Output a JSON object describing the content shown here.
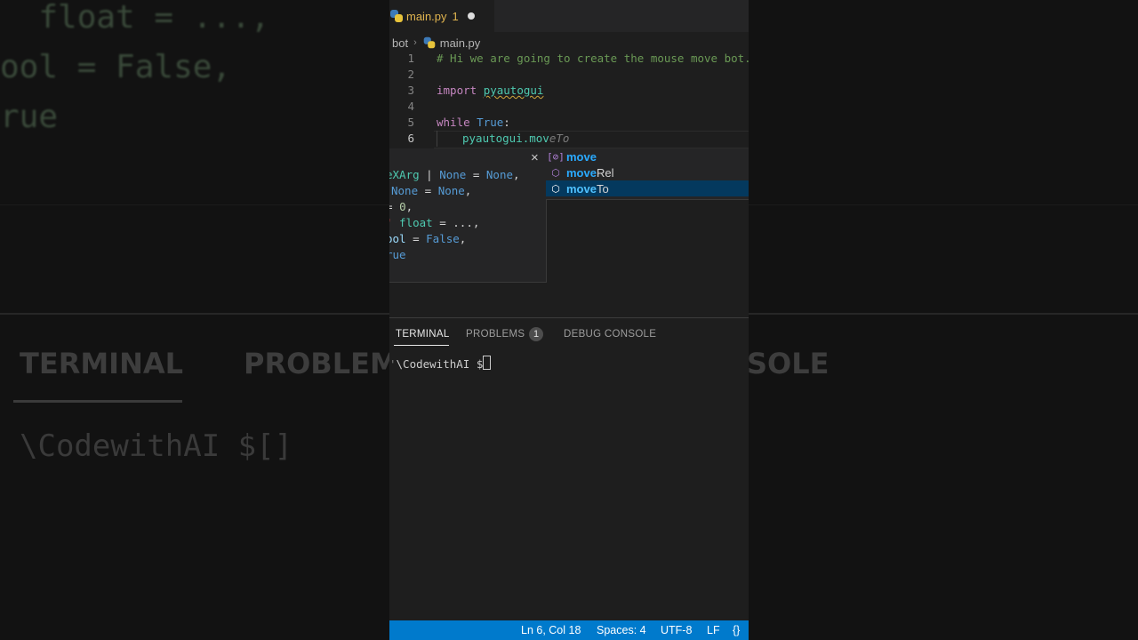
{
  "tab": {
    "filename": "main.py",
    "problem_count": "1"
  },
  "breadcrumb": {
    "folder": "bot",
    "separator": "›",
    "file": "main.py"
  },
  "editor": {
    "line_numbers": [
      "1",
      "2",
      "3",
      "4",
      "5",
      "6"
    ],
    "line1": "# Hi we are going to create the mouse move bot.",
    "line3_keyword": "import",
    "line3_module": "pyautogui",
    "line5_keyword": "while",
    "line5_const": "True",
    "line5_colon": ":",
    "line6_typed": "pyautogui.mov",
    "line6_ghost": "eTo"
  },
  "param_hint": {
    "close_label": "×",
    "line1_a": "eXArg",
    "line1_b": " | ",
    "line1_c": "None",
    "line1_d": " = ",
    "line1_e": "None",
    "line1_f": ",",
    "line2_a": "None",
    "line2_b": " = ",
    "line2_c": "None",
    "line2_d": ",",
    "line3_a": "= ",
    "line3_b": "0",
    "line3_c": ",",
    "line4_mark": "'",
    "line4_a": " float",
    "line4_b": " = ...,",
    "line5_a": "ool",
    "line5_b": " = ",
    "line5_c": "False",
    "line5_d": ",",
    "line6_a": "rue"
  },
  "suggestions": [
    {
      "icon": "[⊘]",
      "match": "move",
      "rest": ""
    },
    {
      "icon": "⬡",
      "match": "move",
      "rest": "Rel"
    },
    {
      "icon": "⬡",
      "match": "move",
      "rest": "To"
    }
  ],
  "panel": {
    "tabs": {
      "terminal": "TERMINAL",
      "problems": "PROBLEMS",
      "problems_count": "1",
      "debug": "DEBUG CONSOLE"
    },
    "terminal_prompt": "\\CodewithAI $"
  },
  "statusbar": {
    "position": "Ln 6, Col 18",
    "spaces": "Spaces: 4",
    "encoding": "UTF-8",
    "eol": "LF",
    "language_icon": "{}"
  },
  "background": {
    "code_1": "  float = ...,",
    "code_2": "ool = False,",
    "code_3": "rue",
    "tab_terminal": "TERMINAL",
    "tab_problems": "PROBLEM",
    "tab_console": "SOLE",
    "terminal": "\\CodewithAI $"
  }
}
